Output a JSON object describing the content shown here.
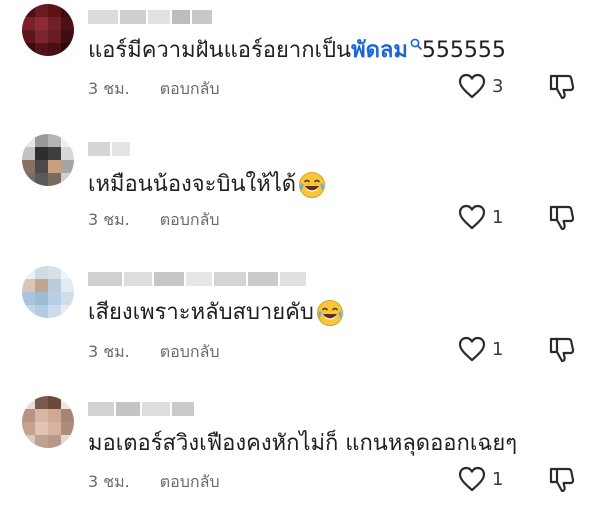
{
  "comments": [
    {
      "time": "3 ชม.",
      "reply_label": "ตอบกลับ",
      "text_prefix": "แอร์มีความฝันแอร์อยากเป็น",
      "keyword": "พัดลม",
      "text_suffix": "555555",
      "likes": "3",
      "emoji": ""
    },
    {
      "time": "3 ชม.",
      "reply_label": "ตอบกลับ",
      "text": "เหมือนน้องจะบินให้ได้",
      "emoji": "laughing-tears",
      "likes": "1"
    },
    {
      "time": "3 ชม.",
      "reply_label": "ตอบกลับ",
      "text": "เสียงเพราะหลับสบายคับ",
      "emoji": "laughing-tears",
      "likes": "1"
    },
    {
      "time": "3 ชม.",
      "reply_label": "ตอบกลับ",
      "text": "มอเตอร์สวิงเฟืองคงหักไม่ก็ แกนหลุดออกเฉยๆ",
      "emoji": "",
      "likes": "1"
    }
  ],
  "colors": {
    "keyword": "#1a66d8",
    "meta": "#6b6b6b",
    "text": "#202020"
  },
  "icons": {
    "like": "heart-outline-icon",
    "dislike": "thumbs-down-outline-icon",
    "search": "search-icon",
    "emoji": "laughing-with-tears-emoji"
  }
}
